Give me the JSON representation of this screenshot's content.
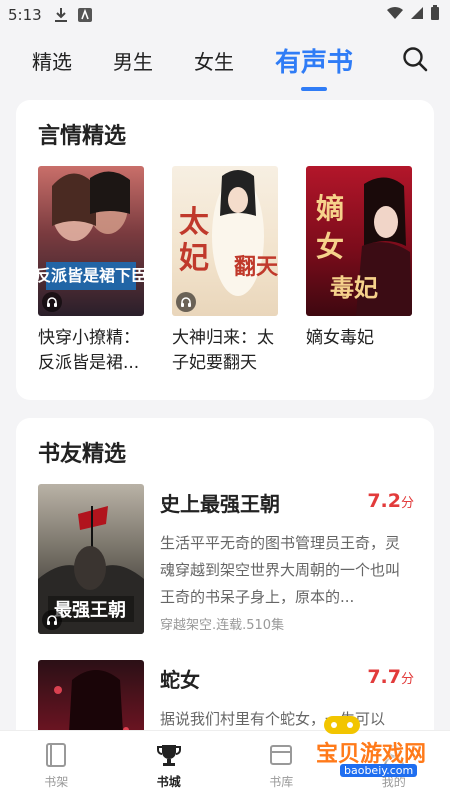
{
  "status_bar": {
    "time": "5:13"
  },
  "top_nav": {
    "tabs": [
      {
        "label": "精选"
      },
      {
        "label": "男生"
      },
      {
        "label": "女生"
      },
      {
        "label": "有声书",
        "active": true
      }
    ],
    "accent_color": "#2f7cf6"
  },
  "section_romance": {
    "title": "言情精选",
    "books": [
      {
        "title_line1": "快穿小撩精：",
        "title_line2": "反派皆是裙..."
      },
      {
        "title_line1": "大神归来：太",
        "title_line2": "子妃要翻天"
      },
      {
        "title_line1": "嫡女毒妃",
        "title_line2": ""
      }
    ]
  },
  "section_friends": {
    "title": "书友精选",
    "items": [
      {
        "title": "史上最强王朝",
        "score": "7.2",
        "score_unit": "分",
        "desc": "生活平平无奇的图书管理员王奇，灵魂穿越到架空世界大周朝的一个也叫王奇的书呆子身上，原本的...",
        "meta": "穿越架空.连载.510集"
      },
      {
        "title": "蛇女",
        "score": "7.7",
        "score_unit": "分",
        "desc": "据说我们村里有个蛇女，一生可以",
        "meta": ""
      }
    ],
    "score_color": "#e23b3b"
  },
  "bottom_nav": {
    "items": [
      {
        "label": "书架",
        "icon": "bookshelf-icon"
      },
      {
        "label": "书城",
        "icon": "trophy-icon",
        "active": true
      },
      {
        "label": "书库",
        "icon": "library-icon"
      },
      {
        "label": "我的",
        "icon": "profile-icon"
      }
    ]
  },
  "watermark": {
    "text": "宝贝游戏网",
    "url": "baobeiy.com"
  }
}
